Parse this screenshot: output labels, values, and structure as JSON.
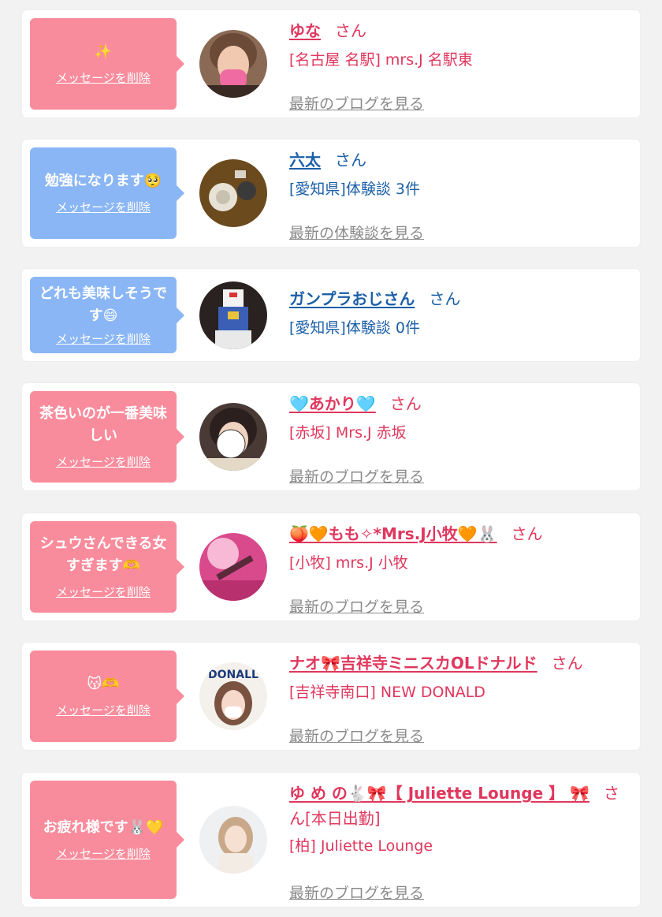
{
  "colors": {
    "pink_bubble": "#f98c9c",
    "blue_bubble": "#8ab6f5",
    "pink_text": "#e0375d",
    "blue_text": "#1b5fa8",
    "link_gray": "#8a8a8a"
  },
  "items": [
    {
      "message": "✨",
      "delete_label": "メッセージを削除",
      "name": "ゆな",
      "honorific": "さん",
      "shop": "[名古屋 名駅] mrs.J 名駅東",
      "link_label": "最新のブログを見る",
      "avatar_icon": "woman-with-mask-photo"
    },
    {
      "message": "勉強になります🥺",
      "delete_label": "メッセージを削除",
      "name": "六太",
      "honorific": "さん",
      "shop": "[愛知県]体験談 3件",
      "link_label": "最新の体験談を見る",
      "avatar_icon": "tabletop-items-photo"
    },
    {
      "message": "どれも美味しそうです😄",
      "delete_label": "メッセージを削除",
      "name": "ガンプラおじさん",
      "honorific": "さん",
      "shop": "[愛知県]体験談 0件",
      "link_label": "",
      "avatar_icon": "robot-figure-photo"
    },
    {
      "message": "茶色いのが一番美味しい",
      "delete_label": "メッセージを削除",
      "name": "🩵あかり🩵",
      "honorific": "さん",
      "shop": "[赤坂] Mrs.J 赤坂",
      "link_label": "最新のブログを見る",
      "avatar_icon": "woman-photo"
    },
    {
      "message": "シュウさんできる女すぎます🫶",
      "delete_label": "メッセージを削除",
      "name": "🍑🧡もも✧*Mrs.J小牧🧡🐰",
      "honorific": "さん",
      "shop": "[小牧] mrs.J 小牧",
      "link_label": "最新のブログを見る",
      "avatar_icon": "pink-light-photo"
    },
    {
      "message": "😽🫶",
      "delete_label": "メッセージを削除",
      "name": "ナオ🎀吉祥寺ミニスカOLドナルド",
      "honorific": "さん",
      "shop": "[吉祥寺南口] NEW DONALD",
      "link_label": "最新のブログを見る",
      "avatar_icon": "woman-with-mask-photo",
      "avatar_text": "DONALL"
    },
    {
      "message": "お疲れ様です🐰💛",
      "delete_label": "メッセージを削除",
      "name": "ゆ め の🐇🎀【 Juliette Lounge 】 🎀",
      "honorific": "さ",
      "name_line2": "ん[本日出勤]",
      "shop": "[柏] Juliette Lounge",
      "link_label": "最新のブログを見る",
      "avatar_icon": "woman-photo"
    }
  ]
}
